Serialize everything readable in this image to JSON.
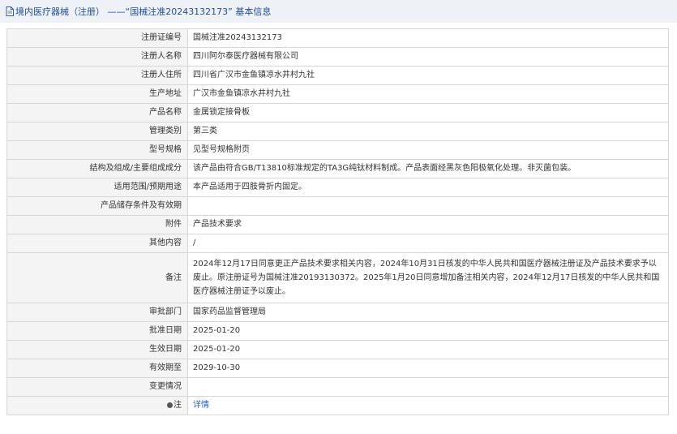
{
  "header": {
    "title": "境内医疗器械（注册） ——“国械注准20243132173” 基本信息",
    "icon": "document-icon"
  },
  "rows": [
    {
      "label": "注册证编号",
      "value": "国械注准20243132173"
    },
    {
      "label": "注册人名称",
      "value": "四川阿尔泰医疗器械有限公司"
    },
    {
      "label": "注册人住所",
      "value": "四川省广汉市金鱼镇凉水井村九社"
    },
    {
      "label": "生产地址",
      "value": "广汉市金鱼镇凉水井村九社"
    },
    {
      "label": "产品名称",
      "value": "金属锁定接骨板"
    },
    {
      "label": "管理类别",
      "value": "第三类"
    },
    {
      "label": "型号规格",
      "value": "见型号规格附页"
    },
    {
      "label": "结构及组成/主要组成成分",
      "value": "该产品由符合GB/T13810标准规定的TA3G纯钛材料制成。产品表面经黑灰色阳极氧化处理。非灭菌包装。"
    },
    {
      "label": "适用范围/预期用途",
      "value": "本产品适用于四肢骨折内固定。"
    },
    {
      "label": "产品储存条件及有效期",
      "value": ""
    },
    {
      "label": "附件",
      "value": "产品技术要求"
    },
    {
      "label": "其他内容",
      "value": "/"
    },
    {
      "label": "备注",
      "value": "2024年12月17日同意更正产品技术要求相关内容，2024年10月31日核发的中华人民共和国医疗器械注册证及产品技术要求予以废止。原注册证号为国械注准20193130372。2025年1月20日同意增加备注相关内容，2024年12月17日核发的中华人民共和国医疗器械注册证予以废止。"
    },
    {
      "label": "审批部门",
      "value": "国家药品监督管理局"
    },
    {
      "label": "批准日期",
      "value": "2025-01-20"
    },
    {
      "label": "生效日期",
      "value": "2025-01-20"
    },
    {
      "label": "有效期至",
      "value": "2029-10-30"
    },
    {
      "label": "变更情况",
      "value": ""
    }
  ],
  "note_row": {
    "label": "注",
    "icon": "bullet-icon",
    "link_text": "详情"
  }
}
